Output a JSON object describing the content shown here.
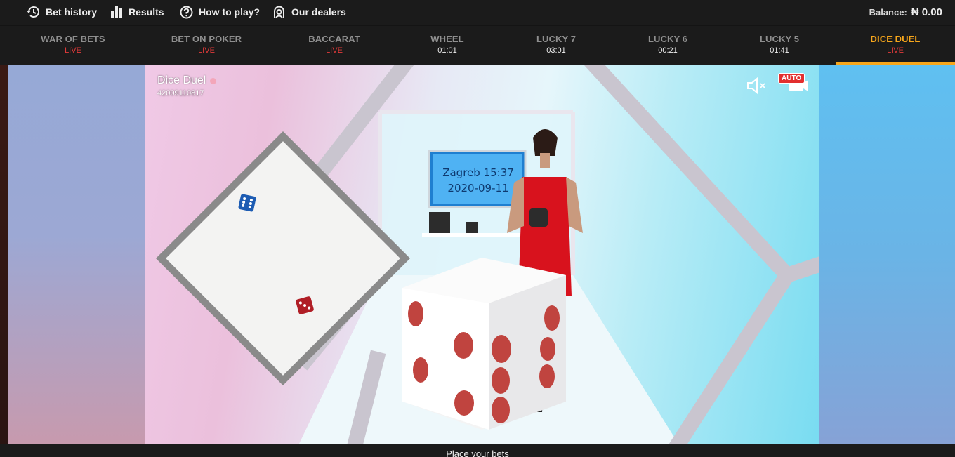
{
  "topbar": {
    "bet_history": "Bet history",
    "results": "Results",
    "how_to_play": "How to play?",
    "our_dealers": "Our dealers",
    "balance_label": "Balance:",
    "balance_value": "₦ 0.00"
  },
  "tabs": [
    {
      "name": "WAR OF BETS",
      "status": "LIVE",
      "live": true
    },
    {
      "name": "BET ON POKER",
      "status": "LIVE",
      "live": true
    },
    {
      "name": "BACCARAT",
      "status": "LIVE",
      "live": true
    },
    {
      "name": "WHEEL",
      "status": "01:01",
      "live": false
    },
    {
      "name": "LUCKY 7",
      "status": "03:01",
      "live": false
    },
    {
      "name": "LUCKY 6",
      "status": "00:21",
      "live": false
    },
    {
      "name": "LUCKY 5",
      "status": "01:41",
      "live": false
    },
    {
      "name": "DICE DUEL",
      "status": "LIVE",
      "live": true,
      "active": true
    }
  ],
  "video": {
    "title": "Dice Duel",
    "round_id": "42009110817",
    "auto_badge": "AUTO",
    "monitor_line1": "Zagreb 15:37",
    "monitor_line2": "2020-09-11"
  },
  "status": {
    "message": "Place your bets"
  },
  "colors": {
    "accent": "#f7a61b",
    "live": "#e33a3a",
    "bar_bg": "#1b1b1b"
  },
  "icons": {
    "bet_history": "history-icon",
    "results": "bar-chart-icon",
    "how_to_play": "question-circle-icon",
    "our_dealers": "dealer-icon",
    "mute": "speaker-muted-icon",
    "camera": "camera-icon"
  }
}
